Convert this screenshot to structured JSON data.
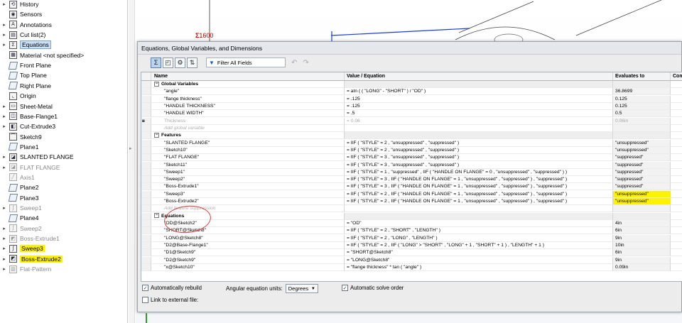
{
  "tree": {
    "items": [
      {
        "label": "History",
        "icon": "history-icon",
        "glyph": "⟲",
        "expandable": true,
        "state": "normal"
      },
      {
        "label": "Sensors",
        "icon": "sensor-icon",
        "glyph": "◉",
        "expandable": false,
        "state": "normal"
      },
      {
        "label": "Annotations",
        "icon": "annotation-icon",
        "glyph": "A",
        "expandable": true,
        "state": "normal"
      },
      {
        "label": "Cut list(2)",
        "icon": "cut-list-icon",
        "glyph": "▤",
        "expandable": true,
        "state": "normal"
      },
      {
        "label": "Equations",
        "icon": "equations-icon",
        "glyph": "Σ",
        "expandable": true,
        "state": "selected"
      },
      {
        "label": "Material <not specified>",
        "icon": "material-icon",
        "glyph": "▦",
        "expandable": false,
        "state": "normal"
      },
      {
        "label": "Front Plane",
        "icon": "plane-icon",
        "glyph": "",
        "expandable": false,
        "state": "normal"
      },
      {
        "label": "Top Plane",
        "icon": "plane-icon",
        "glyph": "",
        "expandable": false,
        "state": "normal"
      },
      {
        "label": "Right Plane",
        "icon": "plane-icon",
        "glyph": "",
        "expandable": false,
        "state": "normal"
      },
      {
        "label": "Origin",
        "icon": "origin-icon",
        "glyph": "⌞",
        "expandable": false,
        "state": "normal"
      },
      {
        "label": "Sheet-Metal",
        "icon": "sheet-metal-icon",
        "glyph": "▭",
        "expandable": true,
        "state": "normal"
      },
      {
        "label": "Base-Flange1",
        "icon": "base-flange-icon",
        "glyph": "◫",
        "expandable": true,
        "state": "normal"
      },
      {
        "label": "Cut-Extrude3",
        "icon": "cut-extrude-icon",
        "glyph": "◧",
        "expandable": true,
        "state": "normal"
      },
      {
        "label": "Sketch9",
        "icon": "sketch-icon",
        "glyph": "⌒",
        "expandable": false,
        "state": "normal"
      },
      {
        "label": "Plane1",
        "icon": "plane-icon",
        "glyph": "",
        "expandable": false,
        "state": "normal"
      },
      {
        "label": "SLANTED FLANGE",
        "icon": "flange-icon",
        "glyph": "◪",
        "expandable": true,
        "state": "normal"
      },
      {
        "label": "FLAT FLANGE",
        "icon": "flange-icon",
        "glyph": "◪",
        "expandable": true,
        "state": "suppressed"
      },
      {
        "label": "Axis1",
        "icon": "axis-icon",
        "glyph": "╱",
        "expandable": false,
        "state": "suppressed"
      },
      {
        "label": "Plane2",
        "icon": "plane-icon",
        "glyph": "",
        "expandable": false,
        "state": "normal"
      },
      {
        "label": "Plane3",
        "icon": "plane-icon",
        "glyph": "",
        "expandable": false,
        "state": "normal"
      },
      {
        "label": "Sweep1",
        "icon": "sweep-icon",
        "glyph": "ʃ",
        "expandable": true,
        "state": "suppressed"
      },
      {
        "label": "Plane4",
        "icon": "plane-icon",
        "glyph": "",
        "expandable": false,
        "state": "normal"
      },
      {
        "label": "Sweep2",
        "icon": "sweep-icon",
        "glyph": "ʃ",
        "expandable": true,
        "state": "suppressed"
      },
      {
        "label": "Boss-Extrude1",
        "icon": "boss-extrude-icon",
        "glyph": "◩",
        "expandable": true,
        "state": "suppressed"
      },
      {
        "label": "Sweep3",
        "icon": "sweep-icon",
        "glyph": "ʃ",
        "expandable": true,
        "state": "highlighted"
      },
      {
        "label": "Boss-Extrude2",
        "icon": "boss-extrude-icon",
        "glyph": "◩",
        "expandable": true,
        "state": "highlighted"
      },
      {
        "label": "Flat-Pattern",
        "icon": "flat-pattern-icon",
        "glyph": "▧",
        "expandable": true,
        "state": "suppressed"
      }
    ]
  },
  "graphics": {
    "dimension_label": "1600"
  },
  "dialog": {
    "title": "Equations, Global Variables, and Dimensions",
    "filter_placeholder": "Filter All Fields",
    "columns": {
      "name": "Name",
      "value": "Value / Equation",
      "evaluates": "Evaluates to",
      "comments": "Comments"
    },
    "sections": [
      {
        "title": "Global Variables",
        "rows": [
          {
            "name": "\"angle\"",
            "value": "= atn ( ( \"LONG\" - \"SHORT\" ) / \"OD\" )",
            "evaluates": "36.8699",
            "style": "normal"
          },
          {
            "name": "\"flange thickness\"",
            "value": "= .125",
            "evaluates": "0.125",
            "style": "normal"
          },
          {
            "name": "\"HANDLE THICKNESS\"",
            "value": "= .125",
            "evaluates": "0.125",
            "style": "normal"
          },
          {
            "name": "\"HANDLE WIDTH\"",
            "value": "= .5",
            "evaluates": "0.5",
            "style": "normal"
          },
          {
            "name": "Thickness",
            "value": "= 0.06",
            "evaluates": "0.06in",
            "style": "suppressed"
          }
        ],
        "add_label": "Add global variable"
      },
      {
        "title": "Features",
        "rows": [
          {
            "name": "\"SLANTED FLANGE\"",
            "value": "= IIF ( \"STYLE\" = 2 , \"unsuppressed\" , \"suppressed\" )",
            "evaluates": "\"unsuppressed\"",
            "style": "normal"
          },
          {
            "name": "\"Sketch10\"",
            "value": "= IIF ( \"STYLE\" = 2 , \"unsuppressed\" , \"suppressed\" )",
            "evaluates": "\"unsuppressed\"",
            "style": "normal"
          },
          {
            "name": "\"FLAT FLANGE\"",
            "value": "= IIF ( \"STYLE\" = 3 , \"unsuppressed\" , \"suppressed\" )",
            "evaluates": "\"suppressed\"",
            "style": "normal"
          },
          {
            "name": "\"Sketch11\"",
            "value": "= IIF ( \"STYLE\" = 3 , \"unsuppressed\" , \"suppressed\" )",
            "evaluates": "\"suppressed\"",
            "style": "normal"
          },
          {
            "name": "\"Sweep1\"",
            "value": "= IIF ( \"STYLE\" = 1 , \"suppressed\" , IIF ( \"HANDLE ON FLANGE\" = 0 , \"unsuppressed\" , \"suppressed\" ) )",
            "evaluates": "\"suppressed\"",
            "style": "normal"
          },
          {
            "name": "\"Sweep2\"",
            "value": "= IIF ( \"STYLE\" = 3 , IIF ( \"HANDLE ON FLANGE\" = 1 , \"unsuppressed\" , \"suppressed\" ) , \"suppressed\" )",
            "evaluates": "\"suppressed\"",
            "style": "normal"
          },
          {
            "name": "\"Boss-Extrude1\"",
            "value": "= IIF ( \"STYLE\" = 3 , IIF ( \"HANDLE ON FLANGE\" = 1 , \"unsuppressed\" , \"suppressed\" ) , \"suppressed\" )",
            "evaluates": "\"suppressed\"",
            "style": "normal"
          },
          {
            "name": "\"Sweep3\"",
            "value": "= IIF ( \"STYLE\" = 2 , IIF ( \"HANDLE ON FLANGE\" = 1 , \"unsuppressed\" , \"suppressed\" ) , \"suppressed\" )",
            "evaluates": "\"unsuppressed\"",
            "style": "highlight"
          },
          {
            "name": "\"Boss-Extrude2\"",
            "value": "= IIF ( \"STYLE\" = 2 , IIF ( \"HANDLE ON FLANGE\" = 1 , \"unsuppressed\" , \"suppressed\" ) , \"suppressed\" )",
            "evaluates": "\"unsuppressed\"",
            "style": "highlight"
          }
        ],
        "add_label": "Add feature suppression"
      },
      {
        "title": "Equations",
        "rows": [
          {
            "name": "\"OD@Sketch2\"",
            "value": "= \"OD\"",
            "evaluates": "4in",
            "style": "normal"
          },
          {
            "name": "\"SHORT@Sketch8\"",
            "value": "= IIF ( \"STYLE\" = 2 , \"SHORT\" , \"LENGTH\" )",
            "evaluates": "6in",
            "style": "normal"
          },
          {
            "name": "\"LONG@Sketch8\"",
            "value": "= IIF ( \"STYLE\" = 2 , \"LONG\" , \"LENGTH\" )",
            "evaluates": "9in",
            "style": "normal"
          },
          {
            "name": "\"D2@Base-Flange1\"",
            "value": "= IIF ( \"STYLE\" = 2 , IIF ( \"LONG\" > \"SHORT\" , \"LONG\" + 1 , \"SHORT\" + 1 ) , \"LENGTH\" + 1 )",
            "evaluates": "10in",
            "style": "normal"
          },
          {
            "name": "\"D1@Sketch9\"",
            "value": "= \"SHORT@Sketch8\"",
            "evaluates": "6in",
            "style": "normal"
          },
          {
            "name": "\"D2@Sketch9\"",
            "value": "= \"LONG@Sketch8\"",
            "evaluates": "9in",
            "style": "normal"
          },
          {
            "name": "\"x@Sketch10\"",
            "value": "= \"flange thickness\" * tan ( \"angle\" )",
            "evaluates": "0.09in",
            "style": "normal"
          }
        ]
      }
    ],
    "options": {
      "auto_rebuild_label": "Automatically rebuild",
      "auto_rebuild_checked": true,
      "angular_units_label": "Angular equation units:",
      "angular_units_value": "Degrees",
      "auto_solve_label": "Automatic solve order",
      "auto_solve_checked": true,
      "link_external_label": "Link to external file:",
      "link_external_checked": false
    }
  },
  "colors": {
    "highlight": "#fff200",
    "annotation_circle": "#e23a3a",
    "selection": "#c9dff5"
  }
}
